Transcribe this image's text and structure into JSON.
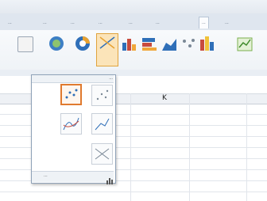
{
  "ribbon_tabs": [
    {
      "label": "..."
    },
    {
      "label": "..."
    },
    {
      "label": "..."
    },
    {
      "label": "..."
    },
    {
      "label": "..."
    },
    {
      "label": "..."
    },
    {
      "label": "..."
    },
    {
      "label": "..."
    }
  ],
  "column_header": {
    "letter": "K"
  },
  "scatter_menu": {
    "header_label": "...",
    "footer_label": "..."
  },
  "colors": {
    "selected_border": "#e07a2e",
    "ribbon_bg": "#dfe6ef"
  }
}
